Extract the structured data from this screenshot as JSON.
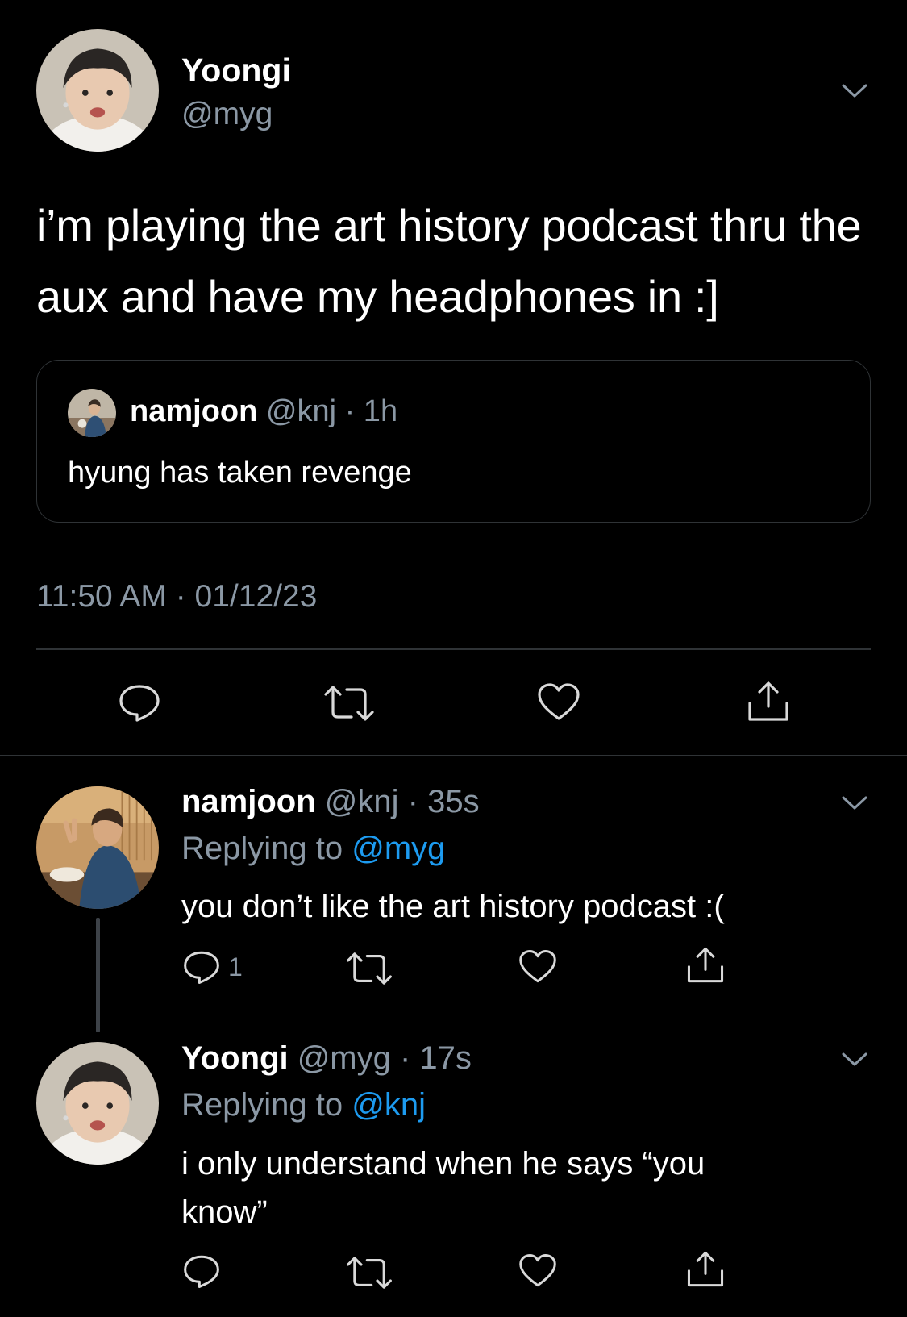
{
  "main_tweet": {
    "author_name": "Yoongi",
    "author_handle": "@myg",
    "text": "i’m playing the art history podcast thru the aux and have my headphones in :]",
    "quote": {
      "author_name": "namjoon",
      "meta": "@knj · 1h",
      "text": "hyung has taken revenge"
    },
    "timestamp": "11:50 AM · 01/12/23"
  },
  "replies": [
    {
      "author_name": "namjoon",
      "meta": "@knj · 35s",
      "replying_prefix": "Replying to ",
      "replying_to": "@myg",
      "text": "you don’t like the art history podcast :(",
      "reply_count": "1"
    },
    {
      "author_name": "Yoongi",
      "meta": "@myg · 17s",
      "replying_prefix": "Replying to ",
      "replying_to": "@knj",
      "text": "i only understand when he says “you know”"
    }
  ],
  "icons": {
    "reply": "speech-bubble-icon",
    "retweet": "retweet-arrows-icon",
    "like": "heart-icon",
    "share": "share-upload-icon",
    "menu": "chevron-down-icon"
  },
  "colors": {
    "background": "#000000",
    "text": "#ffffff",
    "secondary": "#8b98a5",
    "link": "#1d9bf0",
    "border": "#2f3336"
  }
}
